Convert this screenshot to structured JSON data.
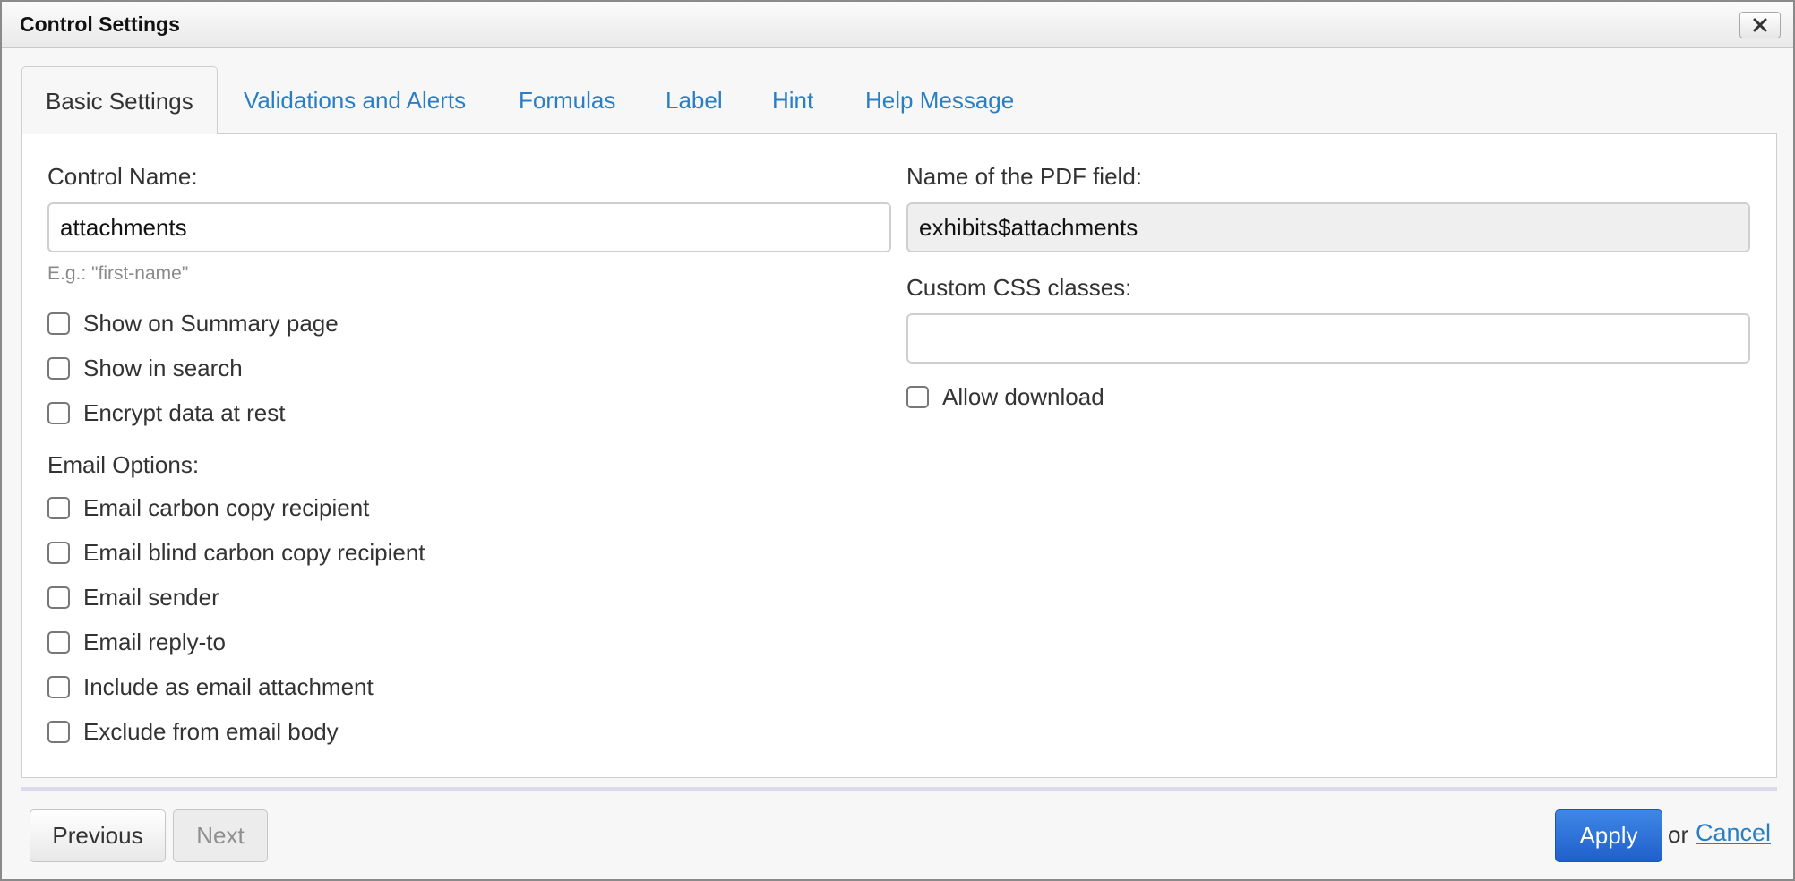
{
  "dialog": {
    "title": "Control Settings"
  },
  "tabs": [
    {
      "label": "Basic Settings",
      "active": true
    },
    {
      "label": "Validations and Alerts"
    },
    {
      "label": "Formulas"
    },
    {
      "label": "Label"
    },
    {
      "label": "Hint"
    },
    {
      "label": "Help Message"
    }
  ],
  "left": {
    "control_name_label": "Control Name:",
    "control_name_value": "attachments",
    "control_name_help": "E.g.: \"first-name\"",
    "options": [
      {
        "label": "Show on Summary page",
        "checked": false
      },
      {
        "label": "Show in search",
        "checked": false
      },
      {
        "label": "Encrypt data at rest",
        "checked": false
      }
    ],
    "email_options_label": "Email Options:",
    "email_options": [
      {
        "label": "Email carbon copy recipient",
        "checked": false
      },
      {
        "label": "Email blind carbon copy recipient",
        "checked": false
      },
      {
        "label": "Email sender",
        "checked": false
      },
      {
        "label": "Email reply-to",
        "checked": false
      },
      {
        "label": "Include as email attachment",
        "checked": false
      },
      {
        "label": "Exclude from email body",
        "checked": false
      }
    ]
  },
  "right": {
    "pdf_field_label": "Name of the PDF field:",
    "pdf_field_value": "exhibits$attachments",
    "css_classes_label": "Custom CSS classes:",
    "css_classes_value": "",
    "allow_download_label": "Allow download",
    "allow_download_checked": false
  },
  "footer": {
    "previous_label": "Previous",
    "next_label": "Next",
    "apply_label": "Apply",
    "or_text": "or",
    "cancel_label": "Cancel"
  },
  "colors": {
    "link": "#2a7fc4",
    "primary_button": "#2a6fd6",
    "divider": "#dcd9ec"
  }
}
